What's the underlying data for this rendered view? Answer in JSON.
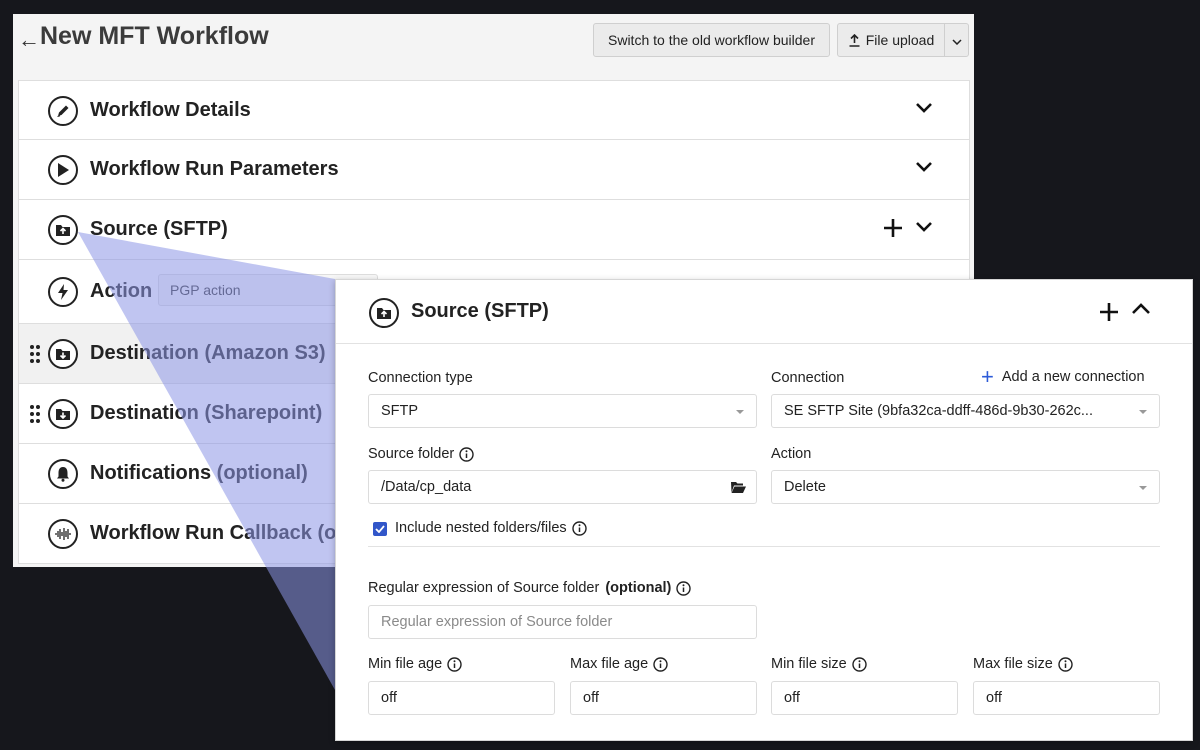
{
  "header": {
    "back_arrow": "←",
    "title": "New MFT Workflow",
    "switch_button": "Switch to the old workflow builder",
    "upload_button": "File upload"
  },
  "accordion": [
    {
      "label": "Workflow Details",
      "icon": "pencil-icon"
    },
    {
      "label": "Workflow Run Parameters",
      "icon": "play-icon"
    },
    {
      "label": "Source (SFTP)",
      "icon": "folder-upload-icon"
    },
    {
      "label": "Action",
      "icon": "lightning-icon",
      "value": "PGP action"
    },
    {
      "label": "Destination (Amazon S3)",
      "icon": "folder-download-icon"
    },
    {
      "label": "Destination (Sharepoint)",
      "icon": "folder-download-icon"
    },
    {
      "label": "Notifications (optional)",
      "icon": "bell-icon"
    },
    {
      "label": "Workflow Run Callback (optional)",
      "icon": "waveform-icon"
    }
  ],
  "panel": {
    "title": "Source (SFTP)",
    "connection_type_label": "Connection type",
    "connection_type_value": "SFTP",
    "connection_label": "Connection",
    "add_connection": "Add a new connection",
    "connection_value": "SE SFTP Site (9bfa32ca-ddff-486d-9b30-262c...",
    "source_folder_label": "Source folder",
    "source_folder_value": "/Data/cp_data",
    "action_label": "Action",
    "action_value": "Delete",
    "nested_label": "Include nested folders/files",
    "nested_checked": true,
    "regex_label": "Regular expression of Source folder",
    "regex_optional": "(optional)",
    "regex_placeholder": "Regular expression of Source folder",
    "min_age_label": "Min file age",
    "min_age_value": "off",
    "max_age_label": "Max file age",
    "max_age_value": "off",
    "min_size_label": "Min file size",
    "min_size_value": "off",
    "max_size_label": "Max file size",
    "max_size_value": "off"
  },
  "colors": {
    "accent": "#3156c9",
    "overlay": "#8c96e6"
  }
}
